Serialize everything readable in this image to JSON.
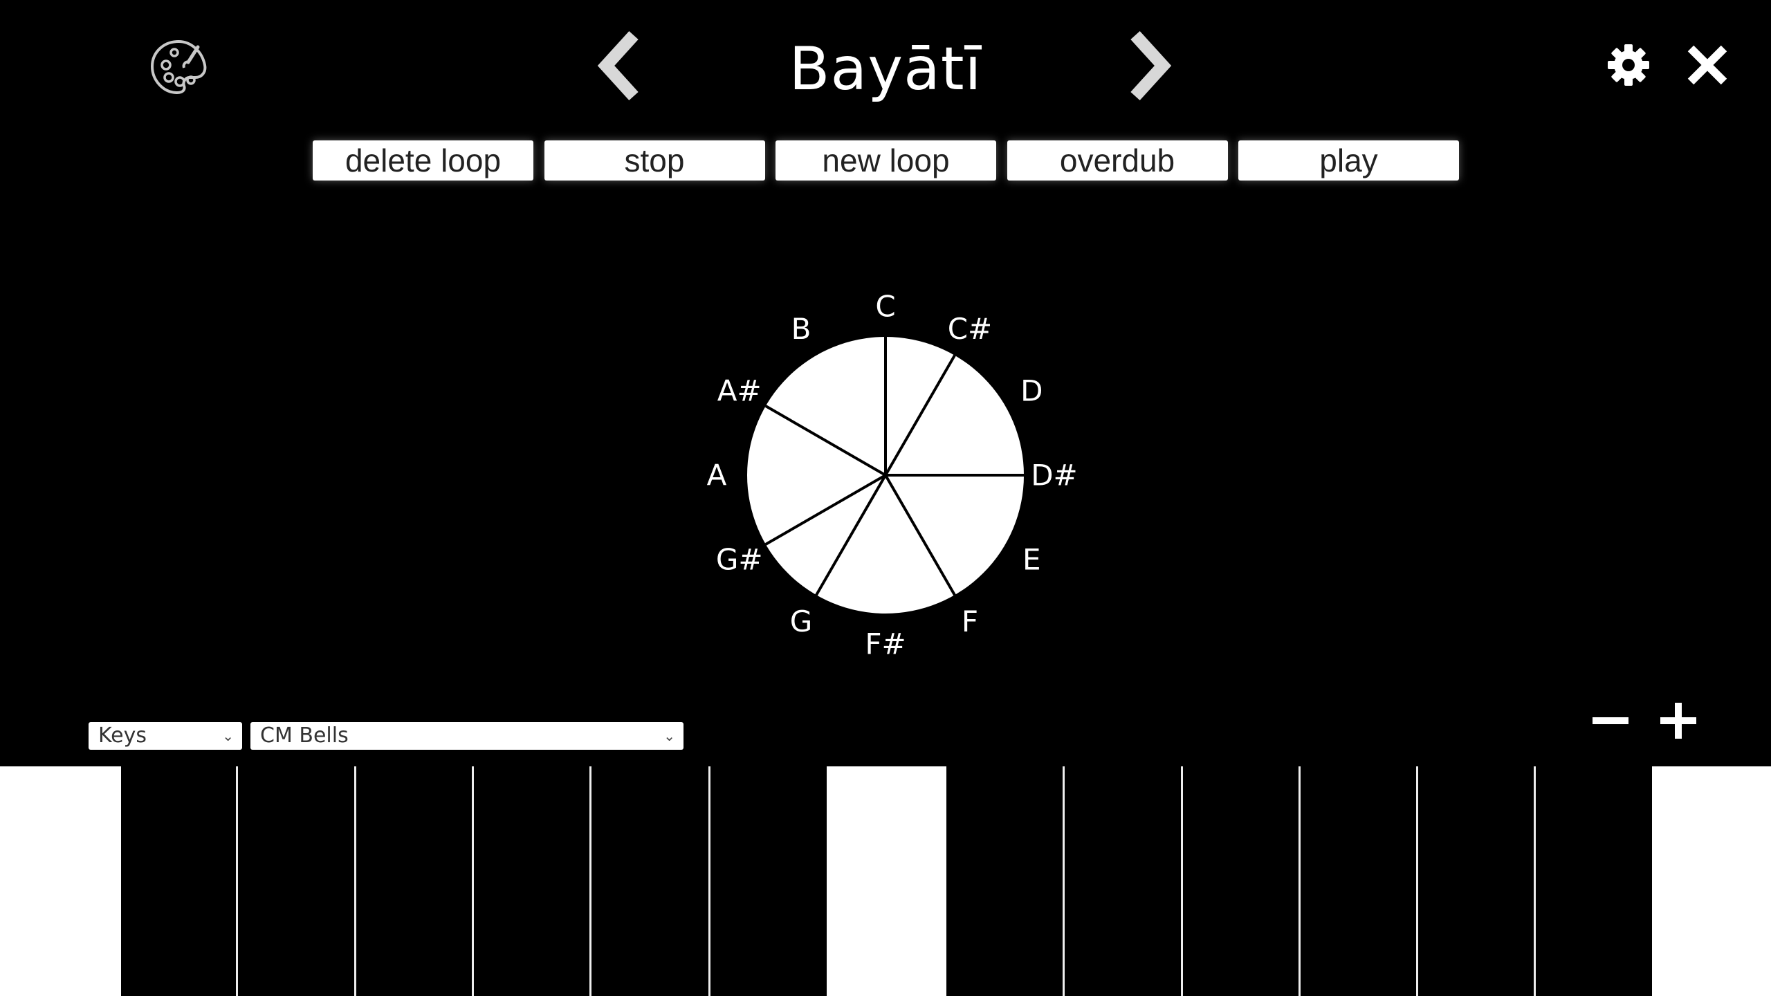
{
  "header": {
    "title": "Bayātī",
    "palette_icon": "palette-icon",
    "prev_icon": "chevron-left-icon",
    "next_icon": "chevron-right-icon",
    "settings_icon": "gear-icon",
    "close_icon": "close-icon"
  },
  "loop_controls": {
    "delete_loop": "delete loop",
    "stop": "stop",
    "new_loop": "new loop",
    "overdub": "overdub",
    "play": "play"
  },
  "note_circle": {
    "notes": [
      "C",
      "C#",
      "D",
      "D#",
      "E",
      "F",
      "F#",
      "G",
      "G#",
      "A",
      "A#",
      "B"
    ],
    "scale_degrees": [
      "C",
      "C#",
      "D#",
      "F",
      "G",
      "G#",
      "A#"
    ]
  },
  "instrument": {
    "input_mode": "Keys",
    "sound": "CM Bells"
  },
  "zoom": {
    "decrease_icon": "minus-icon",
    "increase_icon": "plus-icon"
  },
  "keyboard": {
    "lit_keys": [
      0,
      7,
      14
    ]
  }
}
